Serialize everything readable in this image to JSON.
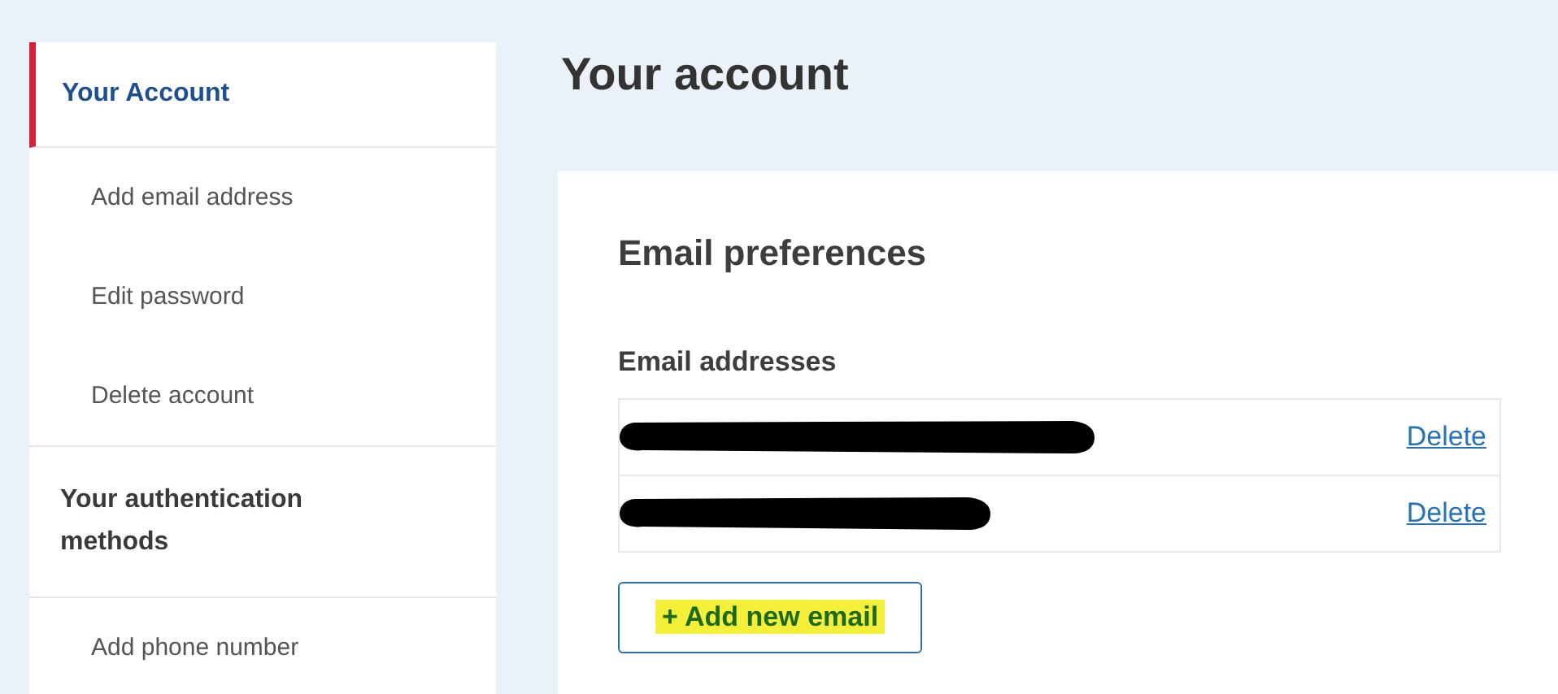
{
  "sidebar": {
    "sections": [
      {
        "heading": "Your Account",
        "selected": true,
        "items": [
          {
            "label": "Add email address",
            "selected": false
          },
          {
            "label": "Edit password",
            "selected": false
          },
          {
            "label": "Delete account",
            "selected": false
          }
        ]
      },
      {
        "heading": "Your authentication methods",
        "selected": false,
        "items": [
          {
            "label": "Add phone number",
            "selected": false
          }
        ]
      }
    ]
  },
  "page_title": "Your account",
  "card": {
    "title": "Email preferences",
    "subtitle": "Email addresses",
    "emails": [
      {
        "redacted": true,
        "action": "Delete"
      },
      {
        "redacted": true,
        "action": "Delete"
      }
    ],
    "add_button": {
      "label": "+ Add new email",
      "highlighted": true
    }
  }
}
